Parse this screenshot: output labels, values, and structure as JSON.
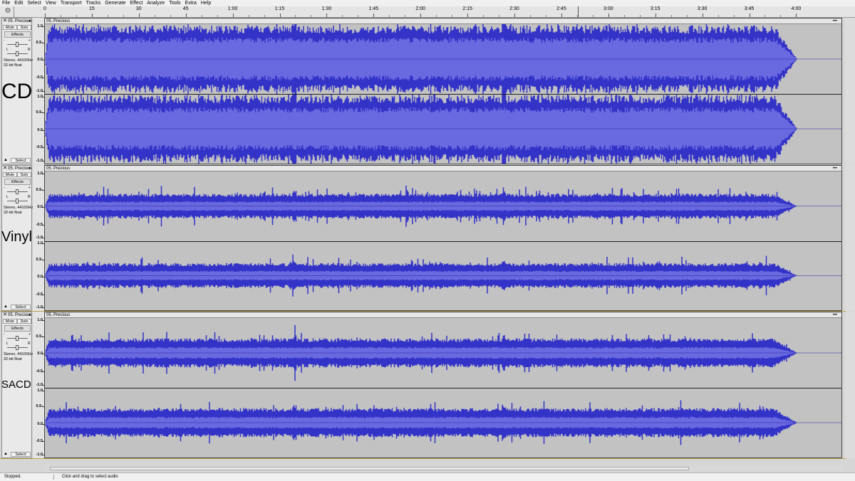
{
  "menu": [
    "File",
    "Edit",
    "Select",
    "View",
    "Transport",
    "Tracks",
    "Generate",
    "Effect",
    "Analyze",
    "Tools",
    "Extra",
    "Help"
  ],
  "ruler": {
    "unit_seconds_max": 244,
    "labels": [
      {
        "t": 0,
        "text": "0"
      },
      {
        "t": 15,
        "text": "15"
      },
      {
        "t": 30,
        "text": "30"
      },
      {
        "t": 45,
        "text": "45"
      },
      {
        "t": 60,
        "text": "1:00"
      },
      {
        "t": 75,
        "text": "1:15"
      },
      {
        "t": 90,
        "text": "1:30"
      },
      {
        "t": 105,
        "text": "1:45"
      },
      {
        "t": 120,
        "text": "2:00"
      },
      {
        "t": 135,
        "text": "2:15"
      },
      {
        "t": 150,
        "text": "2:30"
      },
      {
        "t": 165,
        "text": "2:45"
      },
      {
        "t": 180,
        "text": "3:00"
      },
      {
        "t": 195,
        "text": "3:15"
      },
      {
        "t": 210,
        "text": "3:30"
      },
      {
        "t": 225,
        "text": "3:45"
      },
      {
        "t": 240,
        "text": "4:00"
      }
    ]
  },
  "tracks": [
    {
      "label": "CD",
      "name": "05. Precious",
      "clip_name": "05. Precious",
      "mute": "Mute",
      "solo": "Solo",
      "effects": "Effects",
      "select": "Select",
      "gain_l": "-",
      "gain_r": "+",
      "pan_l": "L",
      "pan_r": "R",
      "info_line1": "Stereo, 44100Hz",
      "info_line2": "32-bit float",
      "scale": {
        "top": "1.0",
        "upper": "0.5-",
        "mid": "0.0",
        "lower": "-0.5",
        "bottom": "-1.0"
      },
      "selected": false,
      "amplitude": {
        "inner": 0.62,
        "outer": 0.97
      }
    },
    {
      "label": "Vinyl",
      "name": "05. Precious",
      "clip_name": "05. Precious",
      "mute": "Mute",
      "solo": "Solo",
      "effects": "Effects",
      "select": "Select",
      "gain_l": "-",
      "gain_r": "+",
      "pan_l": "L",
      "pan_r": "R",
      "info_line1": "Stereo, 44100Hz",
      "info_line2": "32-bit float",
      "scale": {
        "top": "1.0",
        "upper": "0.5-",
        "mid": "0.0",
        "lower": "-0.5",
        "bottom": "-1.0"
      },
      "selected": false,
      "amplitude": {
        "inner": 0.14,
        "outer": 0.36
      }
    },
    {
      "label": "SACD",
      "name": "05. Precious",
      "clip_name": "05. Precious",
      "mute": "Mute",
      "solo": "Solo",
      "effects": "Effects",
      "select": "Select",
      "gain_l": "-",
      "gain_r": "+",
      "pan_l": "L",
      "pan_r": "R",
      "info_line1": "Stereo, 44100Hz",
      "info_line2": "32-bit float",
      "scale": {
        "top": "1.0",
        "upper": "0.5-",
        "mid": "0.0",
        "lower": "-0.5",
        "bottom": "-1.0"
      },
      "selected": true,
      "amplitude": {
        "inner": 0.17,
        "outer": 0.42
      }
    }
  ],
  "colors": {
    "wave_outer": "#3333c8",
    "wave_inner": "#6a6ae0",
    "wave_bg": "#c2c2c2",
    "clip_peak": "#e6e6f0"
  },
  "status": {
    "state": "Stopped.",
    "hint": "Click and drag to select audio"
  }
}
